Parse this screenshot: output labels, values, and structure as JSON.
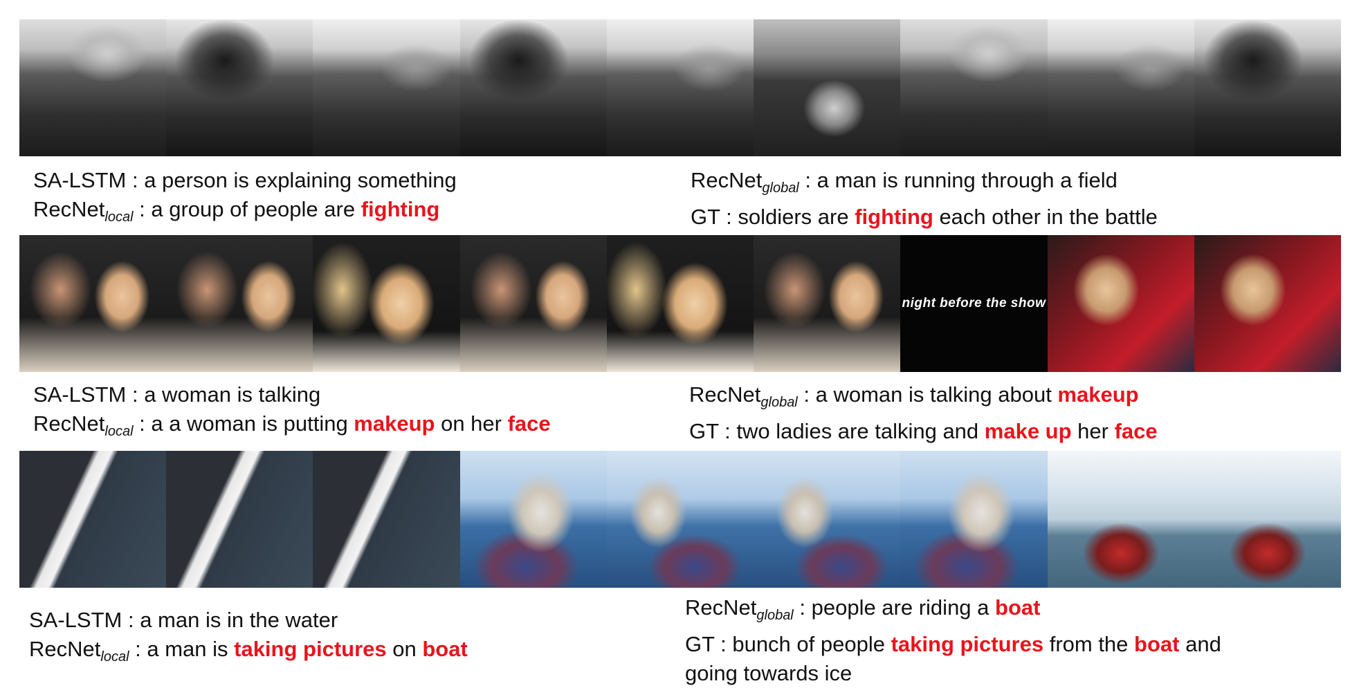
{
  "examples": [
    {
      "frame_overlay_text": "",
      "left": {
        "line1": {
          "model": "SA-LSTM",
          "sub": "",
          "text": " : a person is explaining something"
        },
        "line2": {
          "model": "RecNet",
          "sub": "local",
          "parts": [
            " : a group of people are ",
            "fighting"
          ]
        }
      },
      "right": {
        "line1": {
          "model": "RecNet",
          "sub": "global",
          "text": "  : a man is running through a field"
        },
        "line2": {
          "model": "GT",
          "parts": [
            " : soldiers are ",
            "fighting",
            " each other in the battle"
          ]
        }
      }
    },
    {
      "frame_overlay_text": "night before the show",
      "left": {
        "line1": {
          "model": "SA-LSTM",
          "text": " : a woman is talking"
        },
        "line2": {
          "model": "RecNet",
          "sub": "local",
          "parts": [
            " : a a woman is putting ",
            "makeup",
            " on her ",
            "face"
          ]
        }
      },
      "right": {
        "line1": {
          "model": "RecNet",
          "sub": "global",
          "parts": [
            "  : a woman is talking about ",
            "makeup"
          ]
        },
        "line2": {
          "model": "GT",
          "parts": [
            " : two ladies are talking and ",
            "make up",
            " her ",
            "face"
          ]
        }
      }
    },
    {
      "frame_overlay_text": "",
      "left": {
        "line1": {
          "model": "SA-LSTM",
          "text": " : a man is in the water"
        },
        "line2": {
          "model": "RecNet",
          "sub": "local",
          "parts": [
            " : a man is ",
            "taking pictures",
            " on ",
            "boat"
          ]
        }
      },
      "right": {
        "line1": {
          "model": "RecNet",
          "sub": "global",
          "parts": [
            "  : people are riding a ",
            "boat"
          ]
        },
        "line2": {
          "model": "GT",
          "parts": [
            " : bunch of people ",
            "taking pictures",
            " from the ",
            "boat",
            " and"
          ]
        },
        "line3": {
          "text": "going towards ice"
        }
      }
    }
  ],
  "colors": {
    "highlight": "#e8141c",
    "text": "#111111"
  }
}
